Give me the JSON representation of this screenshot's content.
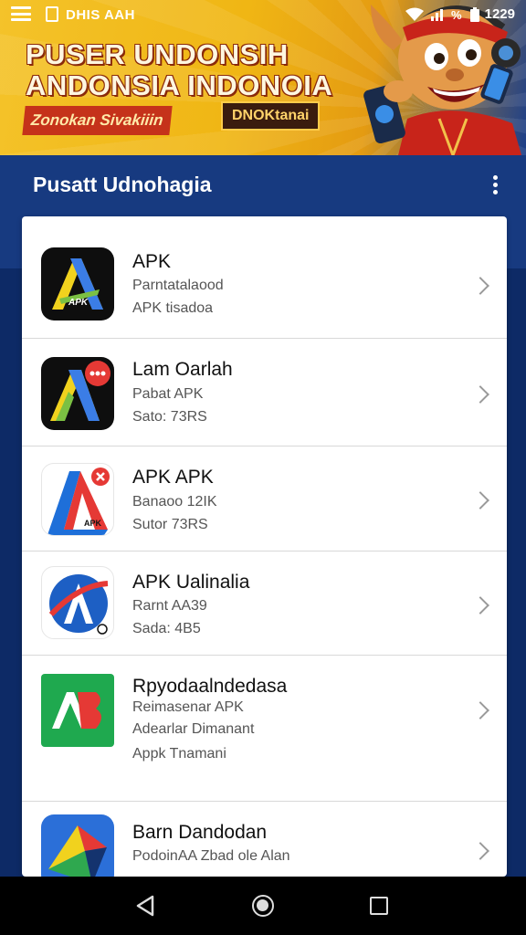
{
  "status_bar": {
    "app_text": "DHIS AAH",
    "time": "1229"
  },
  "banner": {
    "headline_line1": "PUSER UNDONSIH",
    "headline_line2": "ANDONSIA INDONOIA",
    "ribbon_left": "Zonokan Sivakiiin",
    "ribbon_right": "DNOKtanai"
  },
  "app_bar": {
    "title": "Pusatt Udnohagia"
  },
  "apps": [
    {
      "name": "APK",
      "line1": "Parntatalaood",
      "line2": "APK tisadoa",
      "icon": "apk-a-icon"
    },
    {
      "name": "Lam Oarlah",
      "line1": "Pabat APK",
      "line2": "Sato: 73RS",
      "icon": "apk-a-red-badge-icon"
    },
    {
      "name": "APK APK",
      "line1": "Banaoo 12IK",
      "line2": "Sutor 73RS",
      "icon": "apk-red-arrow-icon"
    },
    {
      "name": "APK Ualinalia",
      "line1": "Rarnt AA39",
      "line2": "Sada: 4B5",
      "icon": "apk-globe-a-icon"
    },
    {
      "name": "Rpyodaalndedasa",
      "line1": "Reimasenar APK",
      "line2": "Adearlar Dimanant",
      "line3": "Appk Tnamani",
      "icon": "apk-green-ab-icon"
    },
    {
      "name": "Barn Dandodan",
      "line1": "PodoinAA Zbad ole Alan",
      "line2": "",
      "icon": "apk-plane-icon"
    }
  ],
  "colors": {
    "app_bar": "#173a80",
    "background": "#0d2a66",
    "banner_yellow": "#f0b614",
    "chevron": "#9a9a9a"
  }
}
